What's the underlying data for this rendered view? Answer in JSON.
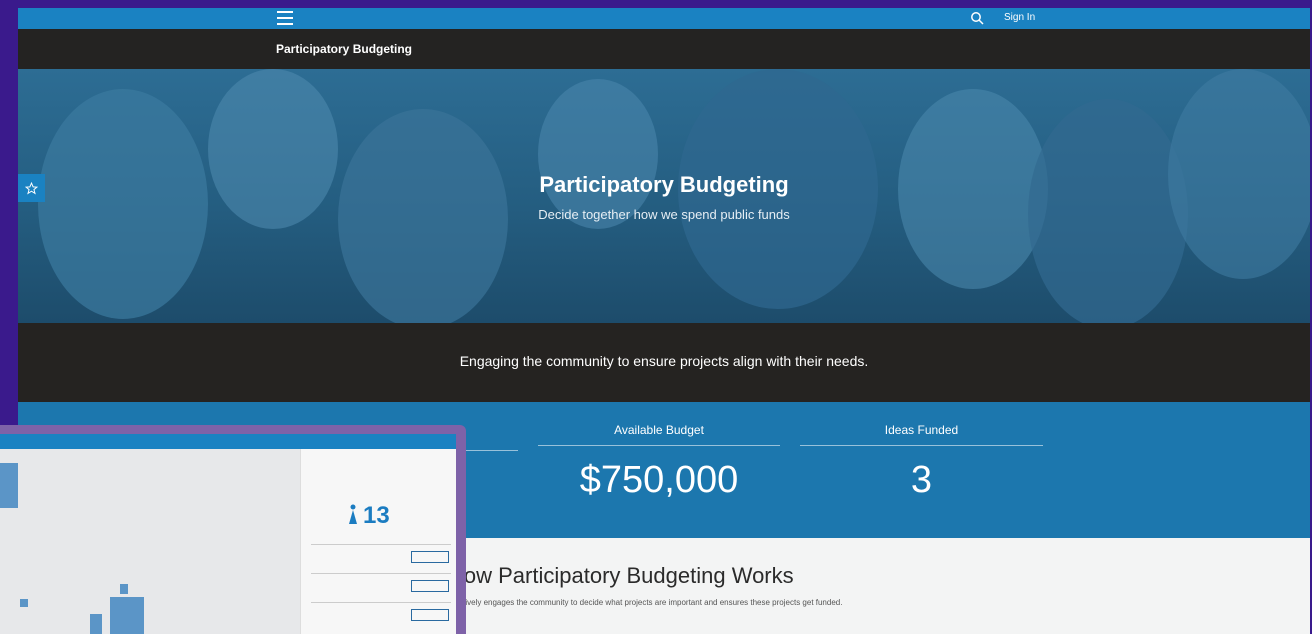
{
  "header": {
    "menu_icon": "hamburger-menu-icon",
    "search_icon": "search-icon",
    "sign_in": "Sign In"
  },
  "titlebar": {
    "title": "Participatory Budgeting"
  },
  "hero": {
    "title": "Participatory Budgeting",
    "subtitle": "Decide together how we spend public funds",
    "favorite_icon": "star-icon"
  },
  "strip": {
    "text": "Engaging the community to ensure projects align with their needs."
  },
  "stats": [
    {
      "label": "Available Budget",
      "value": "$750,000"
    },
    {
      "label": "Ideas Funded",
      "value": "3"
    }
  ],
  "how": {
    "title": "How Participatory Budgeting Works",
    "text": "g actively engages the community to decide what projects are important and ensures these projects get funded."
  },
  "thumbnail": {
    "count": "13",
    "count_icon": "person-icon"
  },
  "colors": {
    "accent": "#1a82c2",
    "dark": "#242322",
    "stats_bg": "#1c77ae",
    "overlay_bg": "#3a1a8c"
  }
}
